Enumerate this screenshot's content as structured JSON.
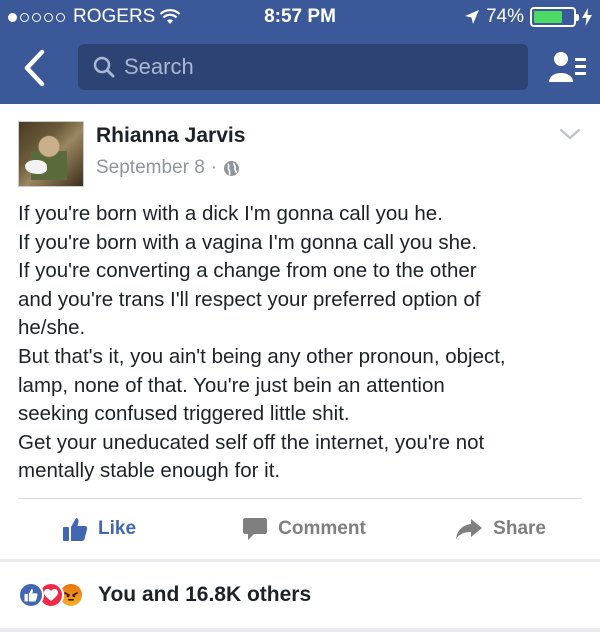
{
  "status_bar": {
    "carrier": "ROGERS",
    "time": "8:57 PM",
    "battery": "74%",
    "battery_level": 0.74,
    "signal_dots": 1
  },
  "nav": {
    "search_placeholder": "Search"
  },
  "post": {
    "author": "Rhianna Jarvis",
    "date": "September 8",
    "separator": "·",
    "lines": [
      "If you're born with a dick I'm gonna call you he.",
      "If you're born with a vagina I'm gonna call you she.",
      "If you're converting a change from one to the other",
      "and you're trans I'll respect your preferred option of",
      "he/she.",
      "But that's it, you ain't being any other pronoun, object,",
      "lamp, none of that. You're just bein an attention",
      "seeking confused triggered little shit.",
      "Get your uneducated self off the internet, you're not",
      "mentally stable enough for it."
    ]
  },
  "actions": {
    "like": "Like",
    "comment": "Comment",
    "share": "Share"
  },
  "reactions": {
    "summary": "You and 16.8K others",
    "icons": [
      "like-icon",
      "love-icon",
      "angry-icon"
    ]
  },
  "colors": {
    "header": "#3b5998",
    "accent": "#4267b2",
    "muted": "#90949c"
  }
}
